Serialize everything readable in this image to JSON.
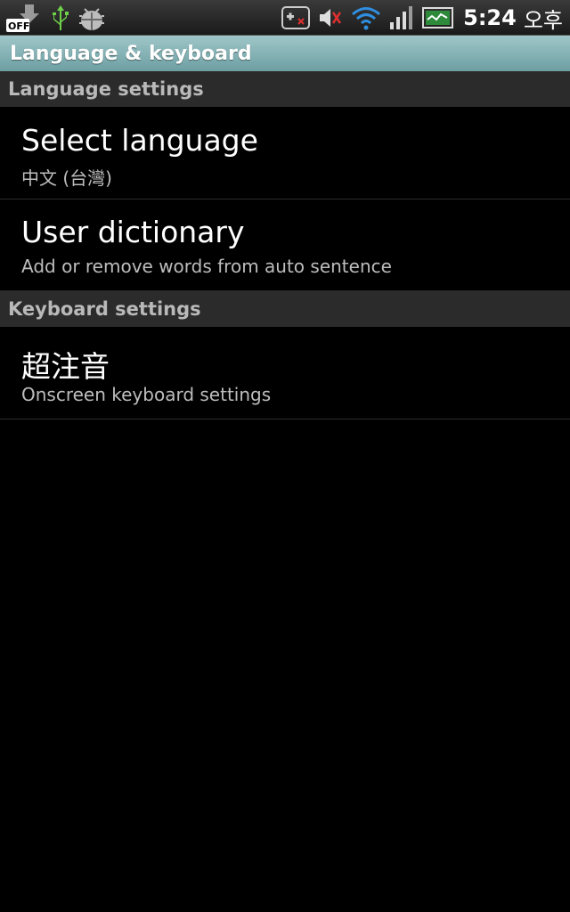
{
  "status_bar": {
    "left_icons": [
      "download-off-icon",
      "usb-icon",
      "android-debug-icon"
    ],
    "off_badge": "OFF",
    "right_icons": [
      "gamepad-icon",
      "volume-muted-icon",
      "wifi-icon",
      "signal-icon",
      "battery-icon"
    ],
    "time": "5:24",
    "time_suffix": "오후"
  },
  "title_bar": {
    "title": "Language & keyboard"
  },
  "sections": {
    "language": {
      "header": "Language settings",
      "items": [
        {
          "title": "Select language",
          "summary": "中文 (台灣)"
        },
        {
          "title": "User dictionary",
          "summary": "Add or remove words from auto sentence"
        }
      ]
    },
    "keyboard": {
      "header": "Keyboard settings",
      "items": [
        {
          "title": "超注音",
          "summary": "Onscreen keyboard settings"
        }
      ]
    }
  },
  "colors": {
    "title_bar": "#7fb0b3",
    "category_bg": "#2b2b2b",
    "category_text": "#b9b9b9",
    "summary_text": "#bdbdbd",
    "background": "#000000"
  }
}
